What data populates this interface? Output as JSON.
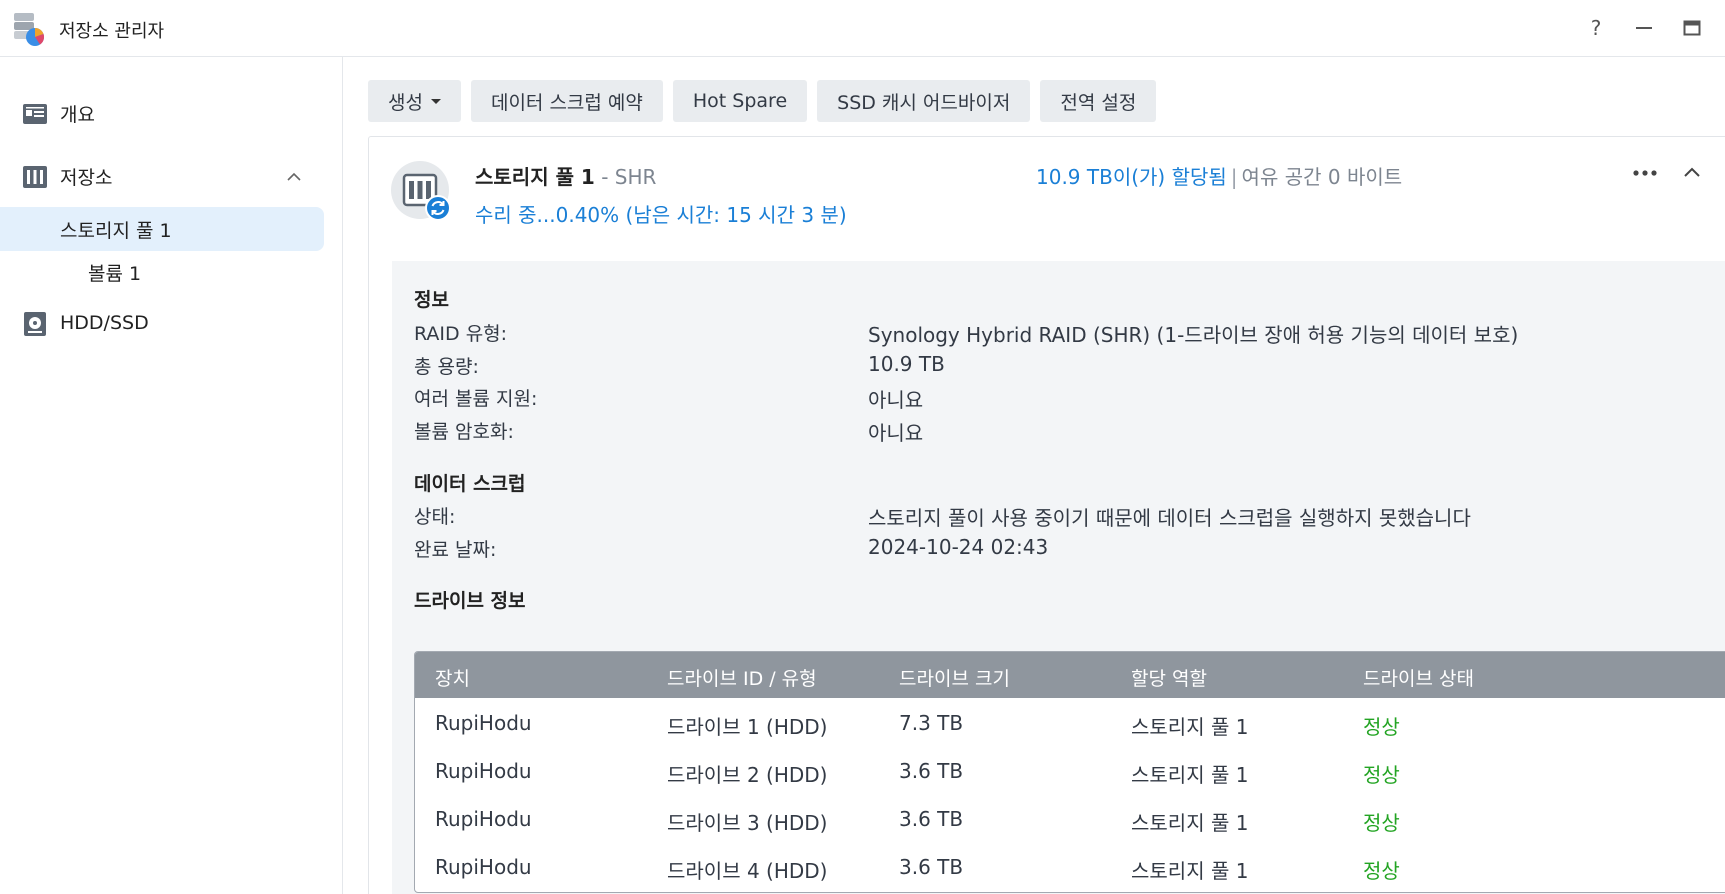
{
  "app": {
    "title": "저장소 관리자"
  },
  "sidebar": {
    "items": [
      {
        "label": "개요"
      },
      {
        "label": "저장소"
      },
      {
        "label": "스토리지 풀 1"
      },
      {
        "label": "볼륨 1"
      },
      {
        "label": "HDD/SSD"
      }
    ]
  },
  "toolbar": {
    "create": "생성",
    "scrub_schedule": "데이터 스크럽 예약",
    "hot_spare": "Hot Spare",
    "ssd_advisor": "SSD 캐시 어드바이저",
    "global_settings": "전역 설정"
  },
  "pool": {
    "name": "스토리지 풀 1",
    "type": "- SHR",
    "status": "수리 중...0.40% (남은 시간: 15 시간 3 분)",
    "allocated": "10.9 TB이(가) 할당됨",
    "separator": "|",
    "free": "여유 공간 0 바이트"
  },
  "info": {
    "title": "정보",
    "rows": [
      {
        "label": "RAID 유형:",
        "value": "Synology Hybrid RAID (SHR) (1-드라이브 장애 허용 기능의 데이터 보호)"
      },
      {
        "label": "총 용량:",
        "value": "10.9 TB"
      },
      {
        "label": "여러 볼륨 지원:",
        "value": "아니요"
      },
      {
        "label": "볼륨 암호화:",
        "value": "아니요"
      }
    ]
  },
  "scrub": {
    "title": "데이터 스크럽",
    "rows": [
      {
        "label": "상태:",
        "value": "스토리지 풀이 사용 중이기 때문에 데이터 스크럽을 실행하지 못했습니다"
      },
      {
        "label": "완료 날짜:",
        "value": "2024-10-24 02:43"
      }
    ]
  },
  "drives": {
    "title": "드라이브 정보",
    "columns": [
      "장치",
      "드라이브 ID / 유형",
      "드라이브 크기",
      "할당 역할",
      "드라이브 상태"
    ],
    "rows": [
      [
        "RupiHodu",
        "드라이브 1 (HDD)",
        "7.3 TB",
        "스토리지 풀 1",
        "정상"
      ],
      [
        "RupiHodu",
        "드라이브 2 (HDD)",
        "3.6 TB",
        "스토리지 풀 1",
        "정상"
      ],
      [
        "RupiHodu",
        "드라이브 3 (HDD)",
        "3.6 TB",
        "스토리지 풀 1",
        "정상"
      ],
      [
        "RupiHodu",
        "드라이브 4 (HDD)",
        "3.6 TB",
        "스토리지 풀 1",
        "정상"
      ]
    ]
  },
  "colors": {
    "accent": "#1a7fd6",
    "status_ok": "#23a423",
    "table_header": "#8f969e",
    "sidebar_active": "#e3f0fc"
  },
  "icons": {
    "app": "storage-manager-icon",
    "help": "help-icon",
    "minimize": "minimize-icon",
    "maximize": "maximize-icon",
    "overview": "overview-icon",
    "storage": "storage-icon",
    "hdd": "hdd-icon",
    "pool": "storage-pool-icon",
    "repair_badge": "repair-sync-icon",
    "more": "more-icon",
    "collapse": "chevron-up-icon"
  }
}
